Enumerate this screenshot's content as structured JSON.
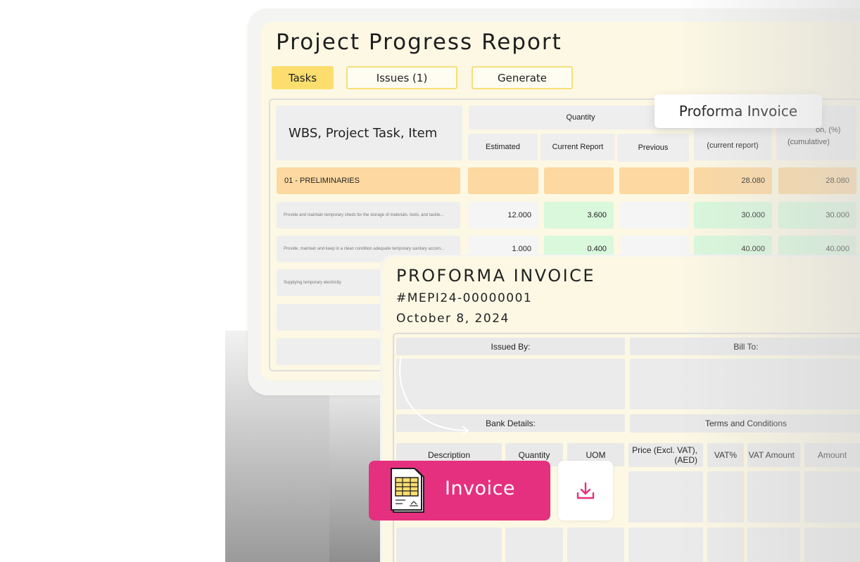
{
  "report": {
    "title": "Project Progress Report",
    "tabs": [
      {
        "label": "Tasks",
        "active": true
      },
      {
        "label": "Issues (1)",
        "active": false
      },
      {
        "label": "Generate",
        "active": false
      }
    ],
    "table": {
      "first_header": "WBS, Project Task, Item",
      "quantity_group": "Quantity",
      "quantity_cols": [
        "Estimated",
        "Current Report",
        "Previous"
      ],
      "completion_current_partial": "(current report)",
      "completion_cumulative_partial": "on, (%)",
      "completion_cumulative_sub": "(cumulative)",
      "rows": [
        {
          "item": "01 - PRELIMINARIES",
          "estimated": "",
          "current": "",
          "previous": "",
          "pct_current": "28.080",
          "pct_cumulative": "28.080"
        },
        {
          "item": "Provide and maintain temporary sheds for the storage of materials, tools, and tackle...",
          "estimated": "12.000",
          "current": "3.600",
          "previous": "",
          "pct_current": "30.000",
          "pct_cumulative": "30.000"
        },
        {
          "item": "Provide, maintain and keep in a clean condition adequate temporary sanitary accom...",
          "estimated": "1.000",
          "current": "0.400",
          "previous": "",
          "pct_current": "40.000",
          "pct_cumulative": "40.000"
        },
        {
          "item": "Supplying temporary electricity"
        }
      ]
    }
  },
  "popup": {
    "label": "Proforma Invoice"
  },
  "invoice": {
    "title": "PROFORMA INVOICE",
    "number": "#MEPI24-00000001",
    "date": "October 8, 2024",
    "issued_by": "Issued By:",
    "bill_to": "Bill To:",
    "bank_details": "Bank Details:",
    "terms": "Terms and Conditions",
    "columns": [
      "Description",
      "Quantity",
      "UOM",
      "Price (Excl. VAT), (AED)",
      "VAT%",
      "VAT Amount",
      "Amount"
    ]
  },
  "actions": {
    "invoice_label": "Invoice",
    "doc_icon": "spreadsheet-document-icon",
    "download_icon": "download-icon",
    "accent": "#e5307f"
  }
}
